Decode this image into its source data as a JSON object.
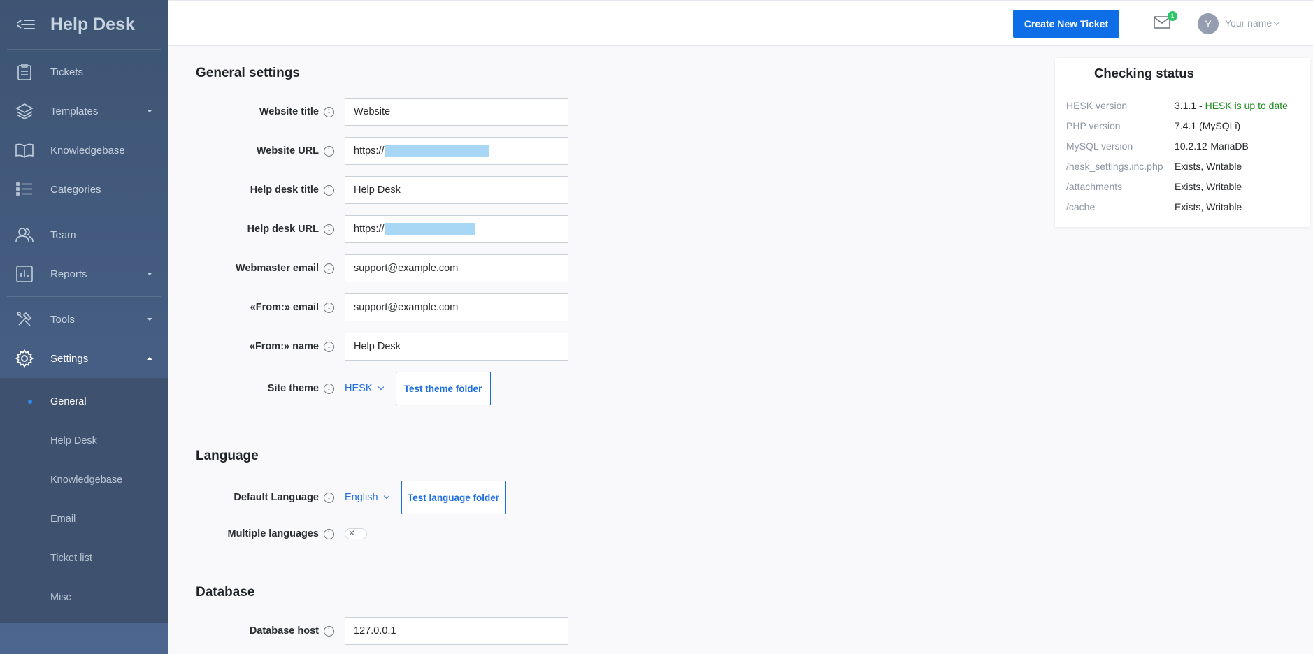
{
  "sidebar": {
    "title": "Help Desk",
    "items": [
      {
        "label": "Tickets",
        "icon": "clipboard-icon"
      },
      {
        "label": "Templates",
        "icon": "layers-icon"
      },
      {
        "label": "Knowledgebase",
        "icon": "book-icon"
      },
      {
        "label": "Categories",
        "icon": "list-icon"
      },
      {
        "label": "Team",
        "icon": "users-icon"
      },
      {
        "label": "Reports",
        "icon": "chart-icon"
      },
      {
        "label": "Tools",
        "icon": "tools-icon"
      },
      {
        "label": "Settings",
        "icon": "gear-icon"
      }
    ],
    "settings_submenu": [
      "General",
      "Help Desk",
      "Knowledgebase",
      "Email",
      "Ticket list",
      "Misc"
    ]
  },
  "topbar": {
    "create_button": "Create New Ticket",
    "mail_badge": "1",
    "avatar_letter": "Y",
    "username": "Your name"
  },
  "general": {
    "title": "General settings",
    "fields": [
      {
        "label": "Website title",
        "value": "Website"
      },
      {
        "label": "Website URL",
        "value": "https://"
      },
      {
        "label": "Help desk title",
        "value": "Help Desk"
      },
      {
        "label": "Help desk URL",
        "value": "https://"
      },
      {
        "label": "Webmaster email",
        "value": "support@example.com"
      },
      {
        "label": "«From:» email",
        "value": "support@example.com"
      },
      {
        "label": "«From:» name",
        "value": "Help Desk"
      }
    ],
    "site_theme": {
      "label": "Site theme",
      "value": "HESK",
      "button": "Test theme folder"
    }
  },
  "language": {
    "title": "Language",
    "default": {
      "label": "Default Language",
      "value": "English",
      "button": "Test language folder"
    },
    "multiple": {
      "label": "Multiple languages",
      "toggle": "✕"
    }
  },
  "database": {
    "title": "Database",
    "host": {
      "label": "Database host",
      "value": "127.0.0.1"
    }
  },
  "status": {
    "title": "Checking status",
    "rows": [
      {
        "key": "HESK version",
        "value": "3.1.1 -",
        "extra": "HESK is up to date"
      },
      {
        "key": "PHP version",
        "value": "7.4.1 (MySQLi)",
        "extra": ""
      },
      {
        "key": "MySQL version",
        "value": "10.2.12-MariaDB",
        "extra": ""
      },
      {
        "key": "/hesk_settings.inc.php",
        "value": "Exists, Writable",
        "extra": ""
      },
      {
        "key": "/attachments",
        "value": "Exists, Writable",
        "extra": ""
      },
      {
        "key": "/cache",
        "value": "Exists, Writable",
        "extra": ""
      }
    ]
  },
  "colors": {
    "primary": "#0d6ee7",
    "sidebar": "#3d5473",
    "ok": "#1a8a1a",
    "redaction": "#a8d6f5"
  }
}
